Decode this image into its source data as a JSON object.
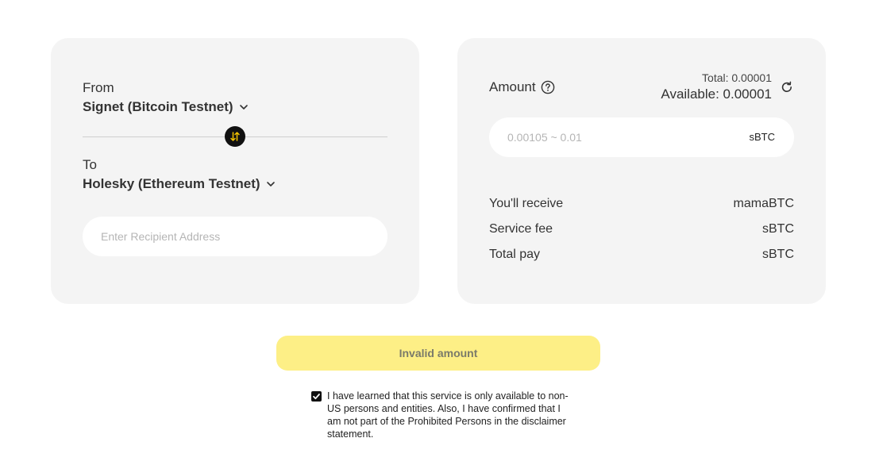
{
  "from_card": {
    "from_label": "From",
    "from_network": "Signet (Bitcoin Testnet)",
    "to_label": "To",
    "to_network": "Holesky (Ethereum Testnet)",
    "recipient_placeholder": "Enter Recipient Address"
  },
  "amount_card": {
    "amount_label": "Amount",
    "total_text": "Total: 0.00001",
    "available_text": "Available: 0.00001",
    "amount_placeholder": "0.00105 ~ 0.01",
    "amount_unit": "sBTC",
    "summary": [
      {
        "label": "You'll receive",
        "value": "mamaBTC"
      },
      {
        "label": "Service fee",
        "value": "sBTC"
      },
      {
        "label": "Total pay",
        "value": "sBTC"
      }
    ]
  },
  "submit": {
    "label": "Invalid amount"
  },
  "agreement": {
    "checked": true,
    "text": "I have learned that this service is only available to non-US persons and entities. Also, I have confirmed that I am not part of the Prohibited Persons in the disclaimer statement."
  },
  "colors": {
    "card_bg": "#f4f4f4",
    "button_bg": "#fdef86",
    "swap_accent": "#f5c400"
  },
  "icons": {
    "swap": "swap-arrows-icon",
    "chevron": "chevron-down-icon",
    "help": "question-circle-icon",
    "refresh": "refresh-icon",
    "check": "checkmark-icon"
  }
}
